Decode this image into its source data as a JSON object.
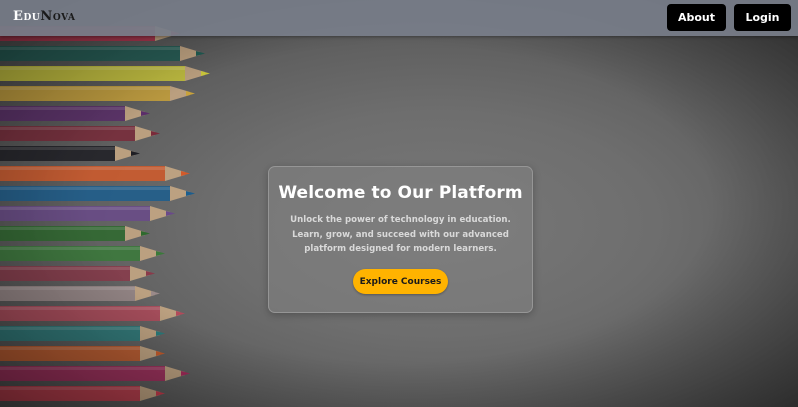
{
  "header": {
    "brand_part1": "Edu",
    "brand_part2": "Nova",
    "nav": {
      "about_label": "About",
      "login_label": "Login"
    }
  },
  "hero": {
    "title": "Welcome to Our Platform",
    "description": "Unlock the power of technology in education. Learn, grow, and succeed with our advanced platform designed for modern learners.",
    "cta_label": "Explore Courses"
  },
  "colors": {
    "header_bg": "#787e8a",
    "nav_button_bg": "#000000",
    "cta_bg": "#ffb300",
    "hero_title": "#ffffff"
  },
  "background": {
    "subject": "colored-pencils-photo"
  }
}
